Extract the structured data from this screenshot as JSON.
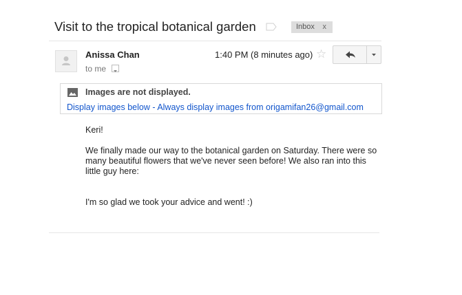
{
  "email": {
    "subject": "Visit to the tropical botanical garden",
    "labels": [
      {
        "name": "Inbox",
        "remove": "x"
      }
    ],
    "sender": "Anissa Chan",
    "recipient_line": "to me",
    "time": "1:40 PM (8 minutes ago)",
    "icons": {
      "label": "label-tag-icon",
      "avatar": "default-avatar-icon",
      "star": "star-outline-icon",
      "reply": "reply-arrow-icon",
      "more": "caret-down-icon",
      "image": "image-placeholder-icon"
    }
  },
  "images_notice": {
    "title": "Images are not displayed.",
    "display_below": "Display images below",
    "separator": " - ",
    "always_display": "Always display images from origamifan26@gmail.com"
  },
  "body": {
    "greeting": "Keri!",
    "paragraph1": "We finally made our way to the botanical garden on Saturday. There were so many beautiful flowers that we've never seen before! We also ran into this little guy here:",
    "paragraph2": "I'm so glad we took your advice and went! :)"
  },
  "colors": {
    "link": "#1155cc",
    "chip_bg": "#dddddd",
    "button_bg": "#f5f5f5"
  }
}
